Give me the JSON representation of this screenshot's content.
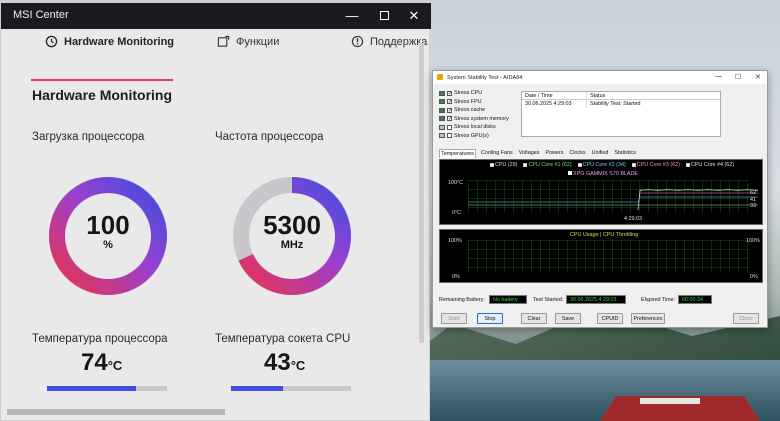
{
  "msi": {
    "window_title": "MSI Center",
    "controls": {
      "minimize": "—",
      "close": "✕"
    },
    "nav": {
      "hardware": "Hardware Monitoring",
      "functions": "Функции",
      "support": "Поддержка"
    },
    "page_title": "Hardware Monitoring",
    "cpu_load": {
      "label": "Загрузка процессора",
      "value": "100",
      "unit": "%",
      "percent": 100
    },
    "cpu_freq": {
      "label": "Частота процессора",
      "value": "5300",
      "unit": "MHz",
      "percent": 68
    },
    "cpu_temp": {
      "label": "Температура процессора",
      "value": "74",
      "unit": "°C",
      "percent": 74
    },
    "socket_temp": {
      "label": "Температура сокета CPU",
      "value": "43",
      "unit": "°C",
      "percent": 43
    },
    "colors": {
      "accent": "#e23a5a",
      "gauge_start": "#e8344f",
      "gauge_end": "#3e4fe0",
      "track": "#c7c7cc"
    }
  },
  "aida": {
    "window_title": "System Stability Test - AIDA64",
    "controls": {
      "minimize": "—",
      "maximize": "☐",
      "close": "✕"
    },
    "stress": [
      {
        "label": "Stress CPU",
        "checked": true
      },
      {
        "label": "Stress FPU",
        "checked": true
      },
      {
        "label": "Stress cache",
        "checked": true
      },
      {
        "label": "Stress system memory",
        "checked": true
      },
      {
        "label": "Stress local disks",
        "checked": false
      },
      {
        "label": "Stress GPU(s)",
        "checked": false
      }
    ],
    "log_headers": {
      "date": "Date / Time",
      "status": "Status"
    },
    "log_rows": [
      {
        "date": "30.06.2025 4:29:03",
        "status": "Stability Test: Started"
      }
    ],
    "tabs": [
      "Temperatures",
      "Cooling Fans",
      "Voltages",
      "Powers",
      "Clocks",
      "Unified",
      "Statistics"
    ],
    "temp_graph": {
      "legend": [
        "CPU (29)",
        "CPU Core #1 (62)",
        "CPU Core #2 (34)",
        "CPU Core #3 (62)",
        "CPU Core #4 (62)"
      ],
      "legend2": "XPG GAMMIX S70 BLADE",
      "y_top": "100°C",
      "y_bottom": "0°C",
      "x_time": "4:29:03",
      "right_values": [
        "62",
        "41",
        "33"
      ]
    },
    "usage_graph": {
      "title": "CPU Usage",
      "separator": "|",
      "throttle": "CPU Throttling",
      "y_top_left": "100%",
      "y_bottom_left": "0%",
      "y_top_right": "100%",
      "y_bottom_right": "0%"
    },
    "status": {
      "battery_label": "Remaining Battery:",
      "battery_value": "No battery",
      "started_label": "Test Started:",
      "started_value": "30.06.2025 4:29:03",
      "elapsed_label": "Elapsed Time:",
      "elapsed_value": "00:00:34"
    },
    "buttons": {
      "start": "Start",
      "stop": "Stop",
      "clear": "Clear",
      "save": "Save",
      "cpuid": "CPUID",
      "preferences": "Preferences",
      "close": "Close"
    }
  }
}
